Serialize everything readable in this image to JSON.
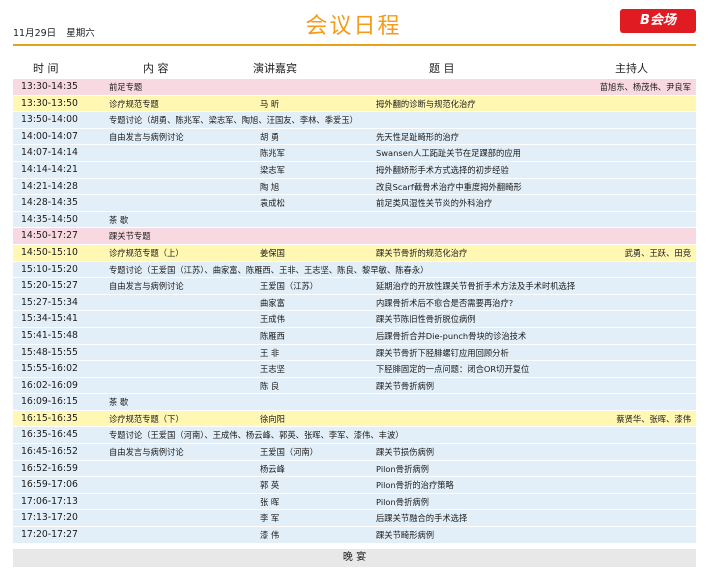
{
  "header": {
    "date": "11月29日",
    "weekday": "星期六",
    "title": "会议日程",
    "badge": "B会场"
  },
  "columns": {
    "time": "时 间",
    "content": "内 容",
    "speaker": "演讲嘉宾",
    "topic": "题 目",
    "host": "主持人"
  },
  "colors": {
    "title": "#f59b1b",
    "badge": "#e11b22",
    "rule": "#e6a21a",
    "row_blue": "#e3eff8",
    "row_pink": "#f8d9e2",
    "row_yellow": "#fff7b2"
  },
  "rows": [
    {
      "style": "pink",
      "time": "13:30-14:35",
      "content": "前足专题",
      "speaker": "",
      "topic": "",
      "host": "苗旭东、杨茂伟、尹良军"
    },
    {
      "style": "yellow",
      "time": "13:30-13:50",
      "content": "诊疗规范专题",
      "speaker": "马 昕",
      "topic": "拇外翻的诊断与规范化治疗",
      "host": ""
    },
    {
      "style": "blue",
      "time": "13:50-14:00",
      "content": "专题讨论（胡勇、陈兆军、梁志军、陶旭、汪国友、李林、季爱玉）",
      "speaker": "",
      "topic": "",
      "host": ""
    },
    {
      "style": "blue",
      "time": "14:00-14:07",
      "content": "自由发言与病例讨论",
      "speaker": "胡 勇",
      "topic": "先天性足趾畸形的治疗",
      "host": ""
    },
    {
      "style": "blue",
      "time": "14:07-14:14",
      "content": "",
      "speaker": "陈兆军",
      "topic": "Swansen人工跖趾关节在足踝部的应用",
      "host": ""
    },
    {
      "style": "blue",
      "time": "14:14-14:21",
      "content": "",
      "speaker": "梁志军",
      "topic": "拇外翻矫形手术方式选择的初步经验",
      "host": ""
    },
    {
      "style": "blue",
      "time": "14:21-14:28",
      "content": "",
      "speaker": "陶 旭",
      "topic": "改良Scarf截骨术治疗中重度拇外翻畸形",
      "host": ""
    },
    {
      "style": "blue",
      "time": "14:28-14:35",
      "content": "",
      "speaker": "袁成松",
      "topic": "前足类风湿性关节炎的外科治疗",
      "host": ""
    },
    {
      "style": "blue",
      "time": "14:35-14:50",
      "content": "茶 歇",
      "speaker": "",
      "topic": "",
      "host": ""
    },
    {
      "style": "pink",
      "time": "14:50-17:27",
      "content": "踝关节专题",
      "speaker": "",
      "topic": "",
      "host": ""
    },
    {
      "style": "yellow",
      "time": "14:50-15:10",
      "content": "诊疗规范专题（上）",
      "speaker": "姜保国",
      "topic": "踝关节骨折的规范化治疗",
      "host": "武勇、王跃、田竞"
    },
    {
      "style": "blue",
      "time": "15:10-15:20",
      "content": "专题讨论（王爱国（江苏）、曲家富、陈雁西、王非、王志坚、陈良、黎早敏、陈春永）",
      "speaker": "",
      "topic": "",
      "host": ""
    },
    {
      "style": "blue",
      "time": "15:20-15:27",
      "content": "自由发言与病例讨论",
      "speaker": "王爱国（江苏）",
      "topic": "延期治疗的开放性踝关节骨折手术方法及手术时机选择",
      "host": ""
    },
    {
      "style": "blue",
      "time": "15:27-15:34",
      "content": "",
      "speaker": "曲家富",
      "topic": "内踝骨折术后不愈合是否需要再治疗?",
      "host": ""
    },
    {
      "style": "blue",
      "time": "15:34-15:41",
      "content": "",
      "speaker": "王成伟",
      "topic": "踝关节陈旧性骨折脱位病例",
      "host": ""
    },
    {
      "style": "blue",
      "time": "15:41-15:48",
      "content": "",
      "speaker": "陈雁西",
      "topic": "后踝骨折合并Die-punch骨块的诊治技术",
      "host": ""
    },
    {
      "style": "blue",
      "time": "15:48-15:55",
      "content": "",
      "speaker": "王 非",
      "topic": "踝关节骨折下胫腓螺钉应用回顾分析",
      "host": ""
    },
    {
      "style": "blue",
      "time": "15:55-16:02",
      "content": "",
      "speaker": "王志坚",
      "topic": "下胫腓固定的一点问题：闭合OR切开复位",
      "host": ""
    },
    {
      "style": "blue",
      "time": "16:02-16:09",
      "content": "",
      "speaker": "陈 良",
      "topic": "踝关节骨折病例",
      "host": ""
    },
    {
      "style": "blue",
      "time": "16:09-16:15",
      "content": "茶 歇",
      "speaker": "",
      "topic": "",
      "host": ""
    },
    {
      "style": "yellow",
      "time": "16:15-16:35",
      "content": "诊疗规范专题（下）",
      "speaker": "徐向阳",
      "topic": "",
      "host": "蔡贤华、张晖、漆伟"
    },
    {
      "style": "blue",
      "time": "16:35-16:45",
      "content": "专题讨论（王爱国（河南）、王成伟、杨云峰、郭英、张晖、李军、漆伟、丰波）",
      "speaker": "",
      "topic": "",
      "host": ""
    },
    {
      "style": "blue",
      "time": "16:45-16:52",
      "content": "自由发言与病例讨论",
      "speaker": "王爱国（河南）",
      "topic": "踝关节损伤病例",
      "host": ""
    },
    {
      "style": "blue",
      "time": "16:52-16:59",
      "content": "",
      "speaker": "杨云峰",
      "topic": "Pilon骨折病例",
      "host": ""
    },
    {
      "style": "blue",
      "time": "16:59-17:06",
      "content": "",
      "speaker": "郭 英",
      "topic": "Pilon骨折的治疗策略",
      "host": ""
    },
    {
      "style": "blue",
      "time": "17:06-17:13",
      "content": "",
      "speaker": "张 晖",
      "topic": "Pilon骨折病例",
      "host": ""
    },
    {
      "style": "blue",
      "time": "17:13-17:20",
      "content": "",
      "speaker": "李 军",
      "topic": "后踝关节融合的手术选择",
      "host": ""
    },
    {
      "style": "blue",
      "time": "17:20-17:27",
      "content": "",
      "speaker": "漆 伟",
      "topic": "踝关节畸形病例",
      "host": ""
    }
  ],
  "footer": "晚 宴"
}
